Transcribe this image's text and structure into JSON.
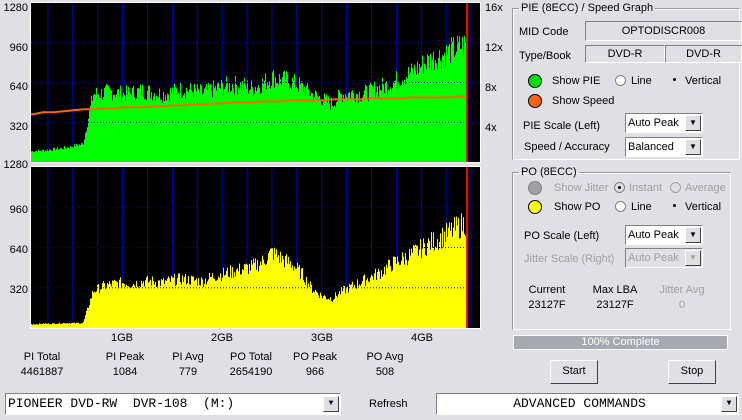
{
  "chart_data": [
    {
      "type": "bar",
      "title": "PIE (8ECC)",
      "ylabel": "PIE",
      "ylim": [
        0,
        1280
      ],
      "yticks": [
        "1280",
        "960",
        "640",
        "320"
      ],
      "xlim": [
        0.08,
        4.59
      ],
      "xticks": [
        "1GB",
        "2GB",
        "3GB",
        "4GB"
      ],
      "xtick_values": [
        1,
        2,
        3,
        4
      ],
      "x_step_gb": 0.1,
      "x_start_gb": 0.1,
      "values": [
        90,
        95,
        105,
        115,
        130,
        150,
        560,
        570,
        580,
        560,
        570,
        590,
        575,
        560,
        580,
        600,
        590,
        570,
        600,
        620,
        640,
        630,
        610,
        650,
        700,
        680,
        660,
        620,
        560,
        520,
        480,
        560,
        570,
        560,
        590,
        620,
        650,
        700,
        740,
        800,
        850,
        880,
        920,
        960,
        990,
        1040
      ],
      "end_marker_gb": 4.46,
      "speed_series": {
        "name": "Speed",
        "yticks_right": [
          "16x",
          "12x",
          "8x",
          "4x"
        ],
        "ylim_right": [
          0,
          16
        ],
        "values": [
          4.8,
          5.0,
          5.0,
          5.1,
          5.2,
          5.3,
          5.3,
          5.4,
          5.4,
          5.5,
          5.5,
          5.5,
          5.6,
          5.6,
          5.7,
          5.7,
          5.8,
          5.8,
          5.9,
          5.9,
          6.0,
          6.0,
          6.0,
          6.1,
          6.1,
          6.1,
          6.2,
          6.2,
          6.2,
          6.2,
          6.3,
          6.3,
          6.3,
          6.3,
          6.4,
          6.4,
          6.4,
          6.4,
          6.5,
          6.5,
          6.5,
          6.5,
          6.5,
          6.6,
          6.6,
          6.6
        ]
      }
    },
    {
      "type": "bar",
      "title": "PO (8ECC)",
      "ylabel": "PO",
      "ylim": [
        0,
        1280
      ],
      "yticks": [
        "1280",
        "960",
        "640",
        "320"
      ],
      "xlim": [
        0.08,
        4.59
      ],
      "x_step_gb": 0.1,
      "x_start_gb": 0.1,
      "values": [
        30,
        35,
        35,
        40,
        40,
        40,
        300,
        340,
        360,
        370,
        360,
        380,
        380,
        370,
        390,
        400,
        390,
        380,
        420,
        440,
        460,
        480,
        500,
        540,
        620,
        560,
        520,
        440,
        320,
        260,
        240,
        300,
        340,
        380,
        420,
        460,
        520,
        560,
        600,
        650,
        700,
        740,
        790,
        840,
        880,
        930
      ]
    }
  ],
  "stats": {
    "pi_total_label": "PI Total",
    "pi_total": "4461887",
    "pi_peak_label": "PI Peak",
    "pi_peak": "1084",
    "pi_avg_label": "PI Avg",
    "pi_avg": "779",
    "po_total_label": "PO Total",
    "po_total": "2654190",
    "po_peak_label": "PO Peak",
    "po_peak": "966",
    "po_avg_label": "PO Avg",
    "po_avg": "508"
  },
  "pie_group": {
    "title": "PIE (8ECC) / Speed Graph",
    "mid_label": "MID Code",
    "mid_value": "OPTODISCR008",
    "type_label": "Type/Book",
    "type_value": "DVD-R",
    "book_value": "DVD-R",
    "show_pie": "Show PIE",
    "line": "Line",
    "vertical": "Vertical",
    "show_speed": "Show Speed",
    "scale_label": "PIE Scale (Left)",
    "scale_value": "Auto Peak",
    "speed_label": "Speed / Accuracy",
    "speed_value": "Balanced",
    "pie_color": "#00ff00",
    "speed_color": "#ff6600"
  },
  "po_group": {
    "title": "PO (8ECC)",
    "show_jitter": "Show Jitter",
    "instant": "Instant",
    "average": "Average",
    "show_po": "Show PO",
    "line": "Line",
    "vertical": "Vertical",
    "scale_label": "PO Scale (Left)",
    "scale_value": "Auto Peak",
    "jitter_scale_label": "Jitter Scale (Right)",
    "jitter_scale_value": "Auto Peak",
    "current_label": "Current",
    "current_value": "23127F",
    "maxlba_label": "Max LBA",
    "maxlba_value": "23127F",
    "jitter_avg_label": "Jitter Avg",
    "jitter_avg_value": "0",
    "po_color": "#ffff00"
  },
  "progress": {
    "label": "100% Complete",
    "percent": 100
  },
  "buttons": {
    "start": "Start",
    "stop": "Stop",
    "refresh": "Refresh"
  },
  "drive": {
    "value": "PIONEER DVD-RW  DVR-108  (M:)"
  },
  "advanced": {
    "value": "ADVANCED COMMANDS"
  }
}
